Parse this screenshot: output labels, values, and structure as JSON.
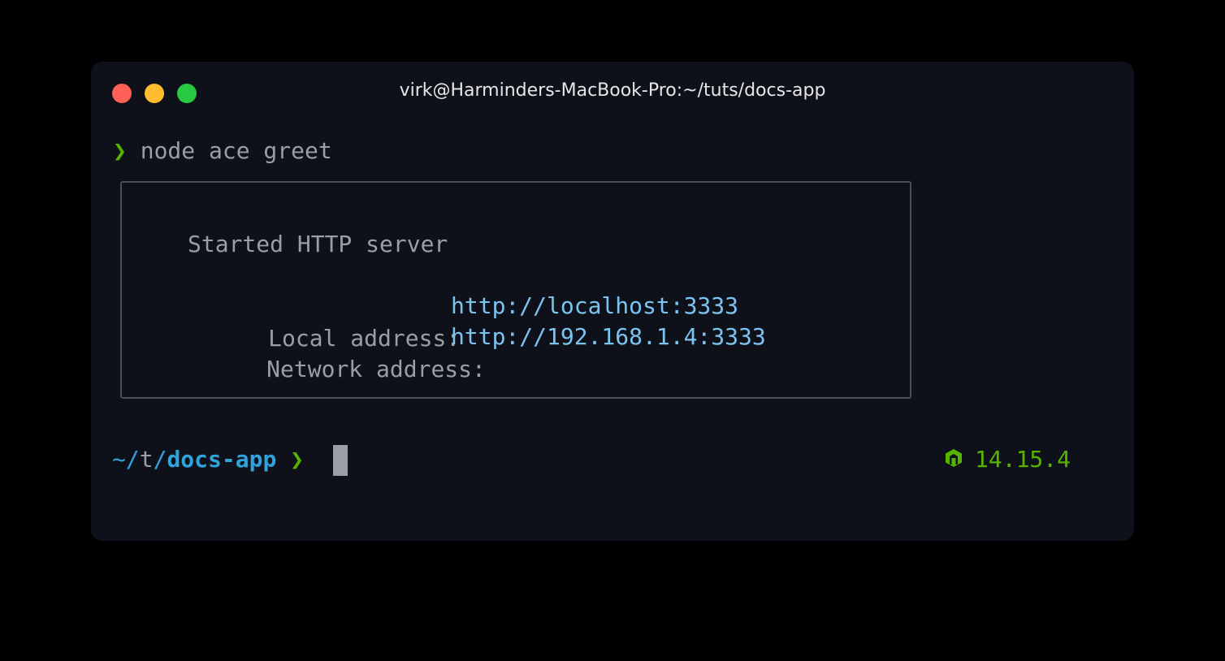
{
  "window": {
    "title": "virk@Harminders-MacBook-Pro:~/tuts/docs-app"
  },
  "traffic_lights": {
    "close_color": "#fe5f57",
    "minimize_color": "#febc2e",
    "zoom_color": "#28c840"
  },
  "command": {
    "prompt_symbol": "❯",
    "text": "node ace greet"
  },
  "output_box": {
    "heading": "Started HTTP server",
    "rows": [
      {
        "label": "Local address:",
        "url": "http://localhost:3333"
      },
      {
        "label": "Network address:",
        "url": "http://192.168.1.4:3333"
      }
    ]
  },
  "prompt": {
    "tilde": "~",
    "t_segment": "/t/",
    "t_prefix": "t",
    "directory": "docs-app",
    "symbol": "❯"
  },
  "node_status": {
    "icon": "node-hexagon-icon",
    "version": "14.15.4"
  },
  "colors": {
    "background": "#0f111a",
    "accent_green": "#56b400",
    "link_blue": "#7cc4f0",
    "dir_blue": "#2fa3dc",
    "muted_text": "#9b9ea6"
  }
}
